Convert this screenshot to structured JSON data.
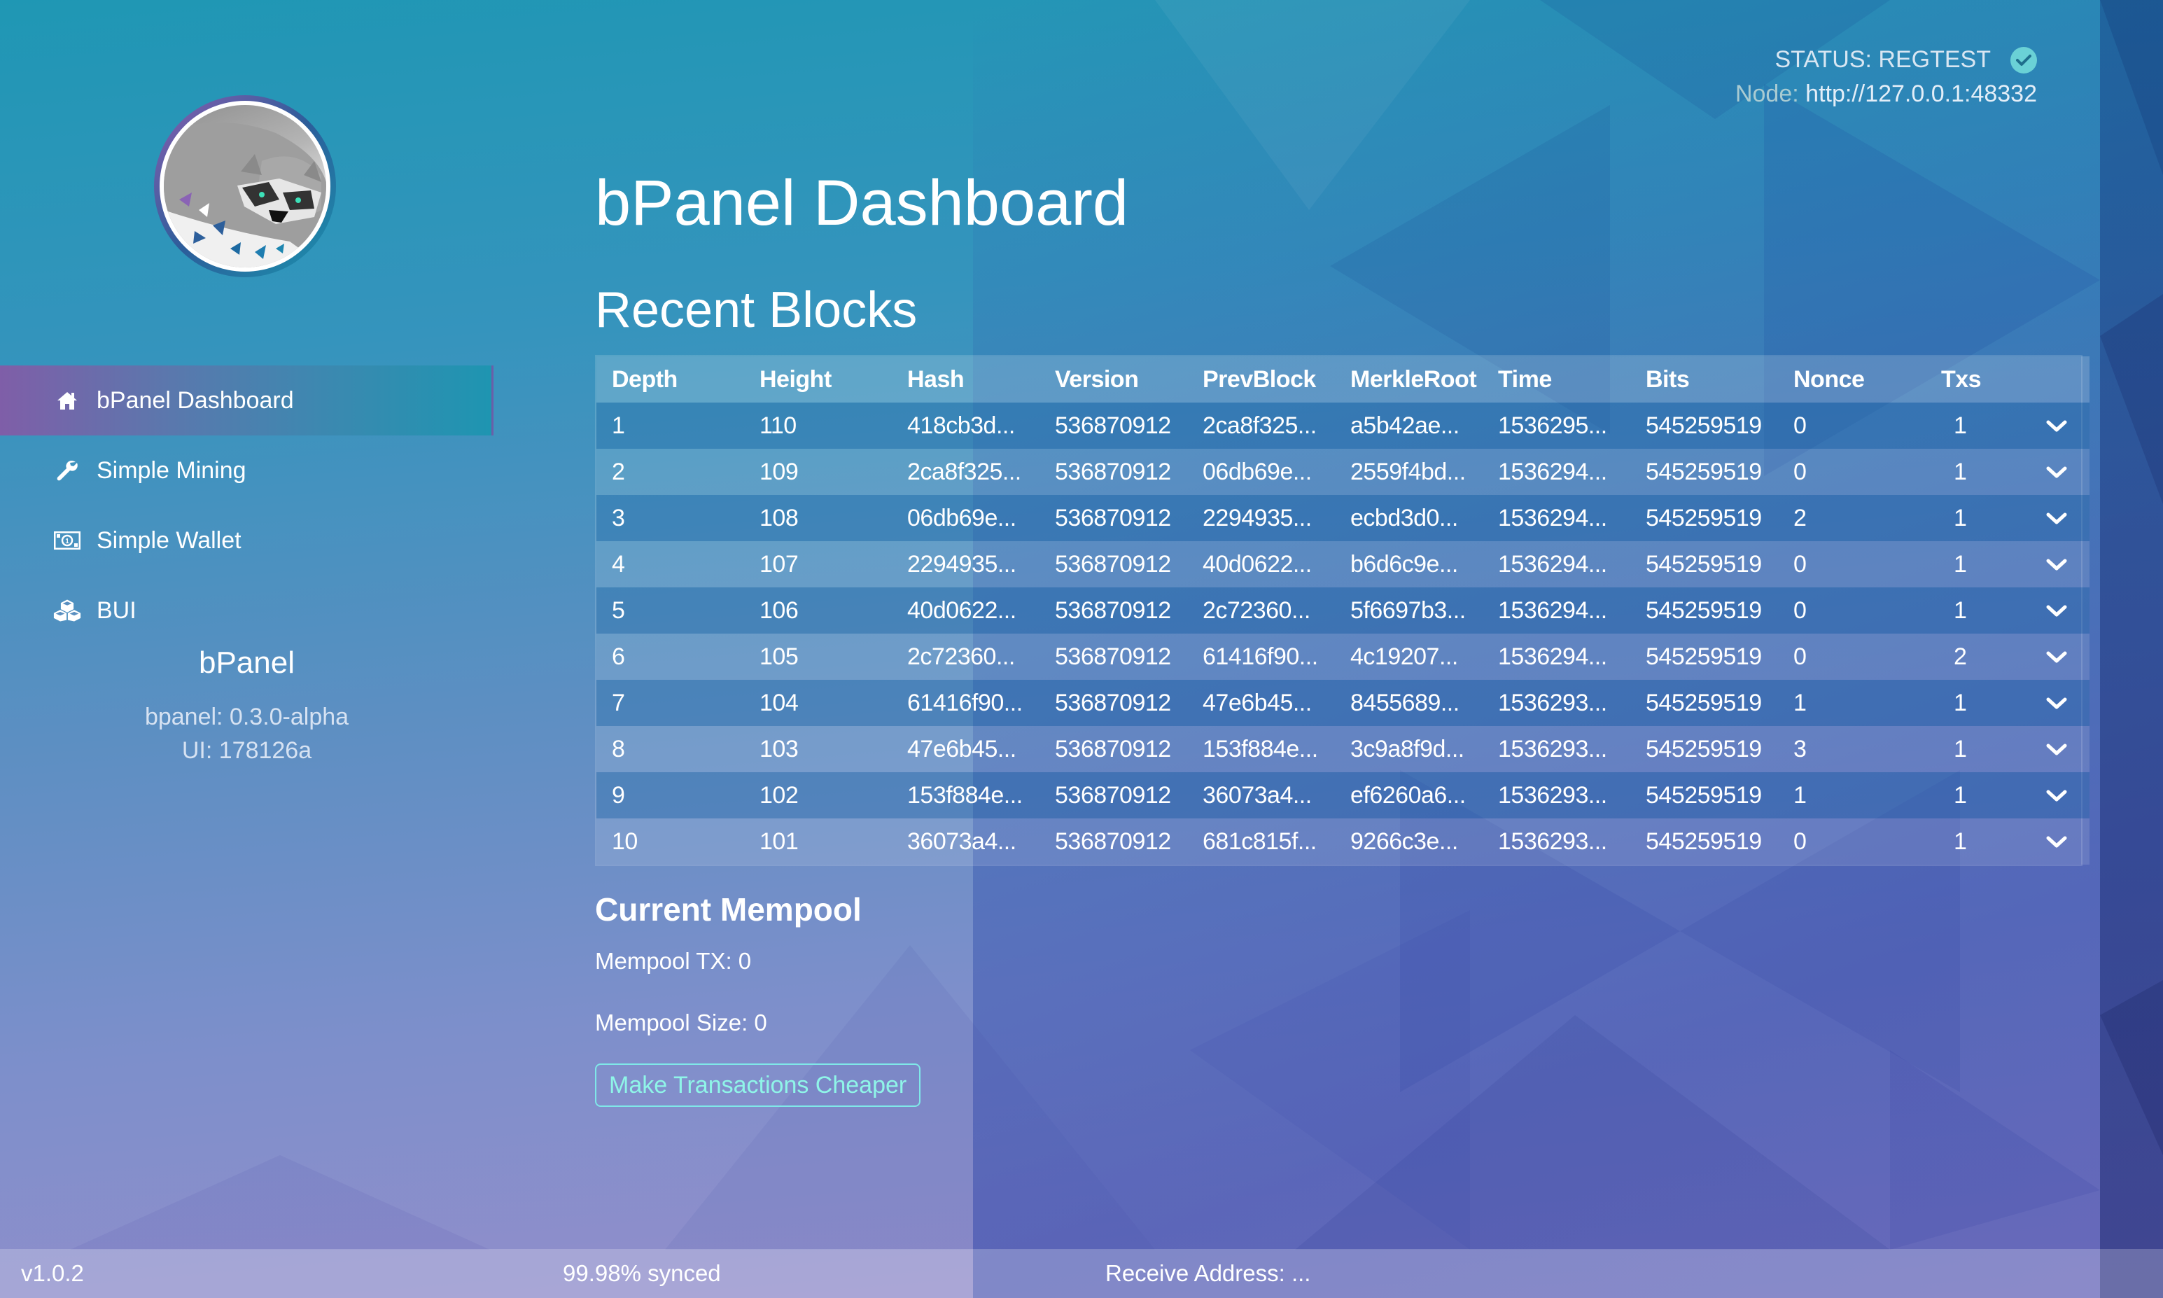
{
  "status": {
    "network_label": "STATUS: REGTEST",
    "node_label": "Node:",
    "node_url": "http://127.0.0.1:48332",
    "status_icon": "check-circle-icon",
    "status_color": "#6ad1d6"
  },
  "sidebar": {
    "logo": "raccoon-logo",
    "items": [
      {
        "label": "bPanel Dashboard",
        "icon": "home-icon",
        "active": true
      },
      {
        "label": "Simple Mining",
        "icon": "wrench-icon",
        "active": false
      },
      {
        "label": "Simple Wallet",
        "icon": "money-bill-icon",
        "active": false
      },
      {
        "label": "BUI",
        "icon": "cubes-icon",
        "active": false
      }
    ],
    "brand_name": "bPanel",
    "bpanel_version": "bpanel: 0.3.0-alpha",
    "ui_version": "UI: 178126a"
  },
  "main": {
    "title": "bPanel Dashboard",
    "recent_blocks_title": "Recent Blocks",
    "table": {
      "columns": [
        "Depth",
        "Height",
        "Hash",
        "Version",
        "PrevBlock",
        "MerkleRoot",
        "Time",
        "Bits",
        "Nonce",
        "Txs"
      ],
      "rows": [
        {
          "depth": "1",
          "height": "110",
          "hash": "418cb3d...",
          "version": "536870912",
          "prev": "2ca8f325...",
          "merkle": "a5b42ae...",
          "time": "1536295...",
          "bits": "545259519",
          "nonce": "0",
          "txs": "1"
        },
        {
          "depth": "2",
          "height": "109",
          "hash": "2ca8f325...",
          "version": "536870912",
          "prev": "06db69e...",
          "merkle": "2559f4bd...",
          "time": "1536294...",
          "bits": "545259519",
          "nonce": "0",
          "txs": "1"
        },
        {
          "depth": "3",
          "height": "108",
          "hash": "06db69e...",
          "version": "536870912",
          "prev": "2294935...",
          "merkle": "ecbd3d0...",
          "time": "1536294...",
          "bits": "545259519",
          "nonce": "2",
          "txs": "1"
        },
        {
          "depth": "4",
          "height": "107",
          "hash": "2294935...",
          "version": "536870912",
          "prev": "40d0622...",
          "merkle": "b6d6c9e...",
          "time": "1536294...",
          "bits": "545259519",
          "nonce": "0",
          "txs": "1"
        },
        {
          "depth": "5",
          "height": "106",
          "hash": "40d0622...",
          "version": "536870912",
          "prev": "2c72360...",
          "merkle": "5f6697b3...",
          "time": "1536294...",
          "bits": "545259519",
          "nonce": "0",
          "txs": "1"
        },
        {
          "depth": "6",
          "height": "105",
          "hash": "2c72360...",
          "version": "536870912",
          "prev": "61416f90...",
          "merkle": "4c19207...",
          "time": "1536294...",
          "bits": "545259519",
          "nonce": "0",
          "txs": "2"
        },
        {
          "depth": "7",
          "height": "104",
          "hash": "61416f90...",
          "version": "536870912",
          "prev": "47e6b45...",
          "merkle": "8455689...",
          "time": "1536293...",
          "bits": "545259519",
          "nonce": "1",
          "txs": "1"
        },
        {
          "depth": "8",
          "height": "103",
          "hash": "47e6b45...",
          "version": "536870912",
          "prev": "153f884e...",
          "merkle": "3c9a8f9d...",
          "time": "1536293...",
          "bits": "545259519",
          "nonce": "3",
          "txs": "1"
        },
        {
          "depth": "9",
          "height": "102",
          "hash": "153f884e...",
          "version": "536870912",
          "prev": "36073a4...",
          "merkle": "ef6260a6...",
          "time": "1536293...",
          "bits": "545259519",
          "nonce": "1",
          "txs": "1"
        },
        {
          "depth": "10",
          "height": "101",
          "hash": "36073a4...",
          "version": "536870912",
          "prev": "681c815f...",
          "merkle": "9266c3e...",
          "time": "1536293...",
          "bits": "545259519",
          "nonce": "0",
          "txs": "1"
        }
      ],
      "row_action_icon": "chevron-down-icon"
    },
    "mempool": {
      "title": "Current Mempool",
      "tx_line": "Mempool TX: 0",
      "size_line": "Mempool Size: 0",
      "button_label": "Make Transactions Cheaper",
      "button_color": "#8ff5e8"
    }
  },
  "footer": {
    "version": "v1.0.2",
    "sync": "99.98% synced",
    "receive_address": "Receive Address: ..."
  }
}
